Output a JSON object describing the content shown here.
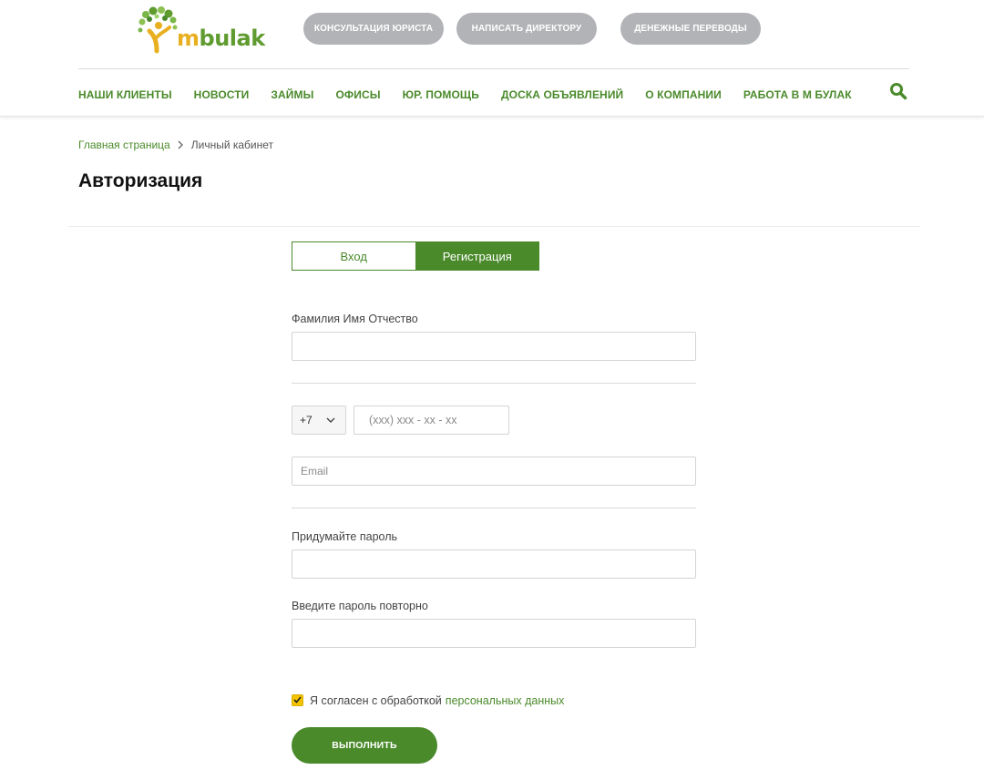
{
  "header": {
    "logo_text_m": "m",
    "logo_text_rest": "bulak",
    "pills": [
      "Консультация юриста",
      "Написать директору",
      "Денежные переводы"
    ],
    "nav": [
      "Наши клиенты",
      "Новости",
      "Займы",
      "Офисы",
      "Юр. помощь",
      "Доска объявлений",
      "О компании",
      "Работа в М Булак"
    ],
    "search_icon": "search-icon"
  },
  "breadcrumb": {
    "home": "Главная страница",
    "current": "Личный кабинет"
  },
  "page": {
    "title": "Авторизация"
  },
  "tabs": {
    "login": "Вход",
    "register": "Регистрация",
    "active": "register"
  },
  "form": {
    "fullname_label": "Фамилия Имя Отчество",
    "fullname_value": "",
    "phone_code": "+7",
    "phone_placeholder": "(xxx) xxx - xx - xx",
    "email_placeholder": "Email",
    "password_label": "Придумайте пароль",
    "password_repeat_label": "Введите пароль повторно",
    "consent_text": "Я согласен с обработкой",
    "consent_link": "персональных данных",
    "consent_checked": true,
    "submit_label": "Выполнить"
  },
  "colors": {
    "brand_green": "#4a8a2b",
    "pill_gray": "#b1b3b6",
    "checkbox_yellow": "#f5c400",
    "logo_yellow": "#e8b020"
  }
}
